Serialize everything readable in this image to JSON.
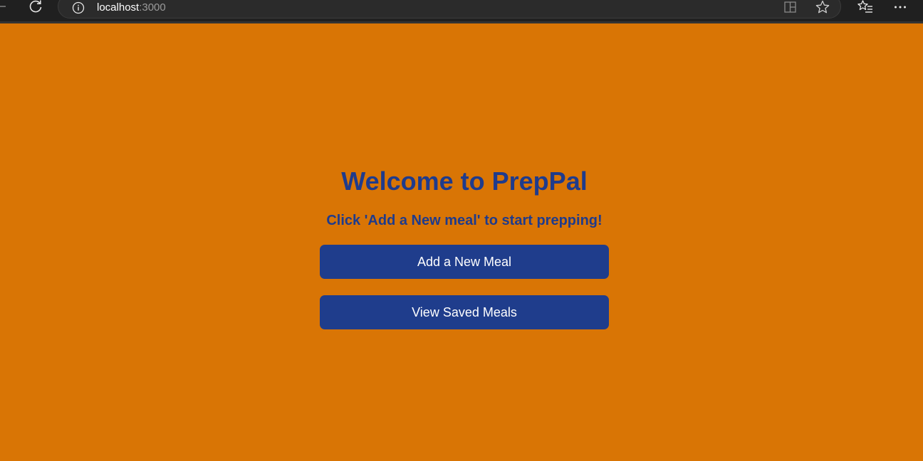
{
  "browser": {
    "url_host": "localhost",
    "url_port": ":3000",
    "icons": [
      "refresh-icon",
      "info-icon",
      "split-screen-icon",
      "favorite-star-icon",
      "favorites-icon",
      "more-menu-icon"
    ]
  },
  "app": {
    "title": "Welcome to PrepPal",
    "subtitle": "Click 'Add a New meal' to start prepping!",
    "add_meal_label": "Add a New Meal",
    "view_saved_label": "View Saved Meals"
  },
  "colors": {
    "page_background": "#d97505",
    "heading_text": "#1f3b8c",
    "button_background": "#1f3d8c",
    "button_text": "#ffffff",
    "browser_bar": "#202020"
  }
}
